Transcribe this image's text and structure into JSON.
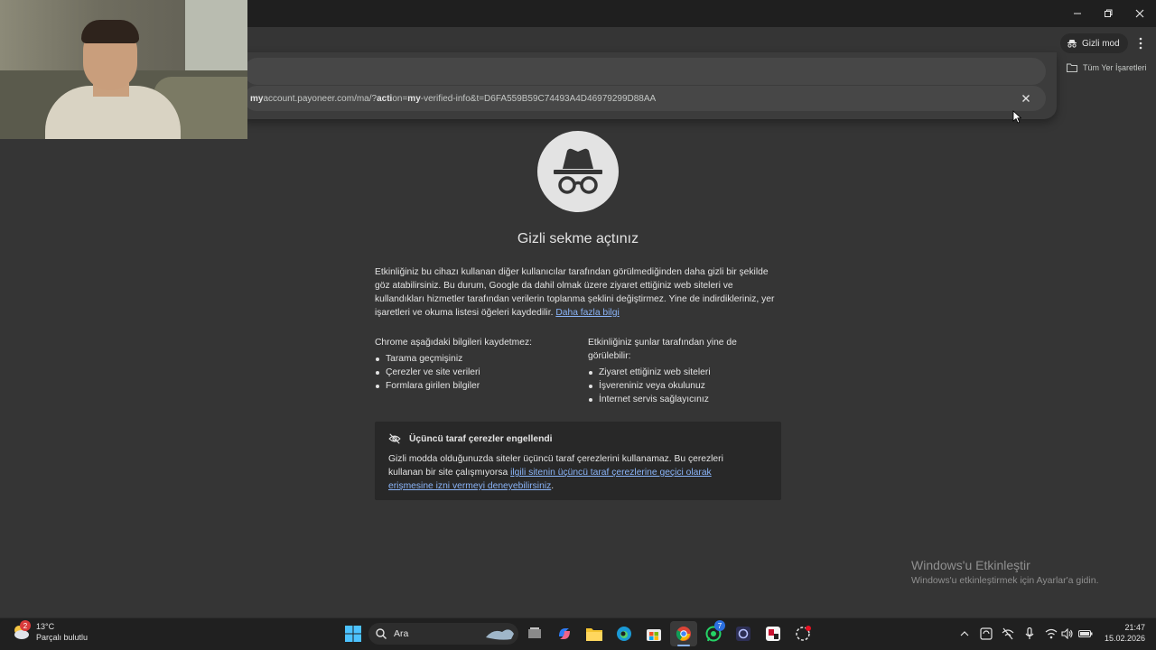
{
  "window": {
    "minimize_icon": "minimize-icon",
    "maximize_icon": "restore-icon",
    "close_icon": "close-icon"
  },
  "toolbar": {
    "incognito_label": "Gizli mod",
    "bookmarks_label": "Tüm Yer İşaretleri"
  },
  "omnibox": {
    "suggestion_bold1": "my",
    "suggestion_text1": "account.payoneer.com/ma/?",
    "suggestion_bold2": "acti",
    "suggestion_text2": "on=",
    "suggestion_bold3": "my",
    "suggestion_text3": "-verified-info&t=D6FA559B59C74493A4D46979299D88AA"
  },
  "page": {
    "title": "Gizli sekme açtınız",
    "intro": "Etkinliğiniz bu cihazı kullanan diğer kullanıcılar tarafından görülmediğinden daha gizli bir şekilde göz atabilirsiniz. Bu durum, Google da dahil olmak üzere ziyaret ettiğiniz web siteleri ve kullandıkları hizmetler tarafından verilerin toplanma şeklini değiştirmez. Yine de indirdikleriniz, yer işaretleri ve okuma listesi öğeleri kaydedilir.",
    "learn_more": "Daha fazla bilgi",
    "left_heading": "Chrome aşağıdaki bilgileri kaydetmez:",
    "left_items": [
      "Tarama geçmişiniz",
      "Çerezler ve site verileri",
      "Formlara girilen bilgiler"
    ],
    "right_heading": "Etkinliğiniz şunlar tarafından yine de görülebilir:",
    "right_items": [
      "Ziyaret ettiğiniz web siteleri",
      "İşvereniniz veya okulunuz",
      "İnternet servis sağlayıcınız"
    ],
    "cookie_title": "Üçüncü taraf çerezler engellendi",
    "cookie_text": "Gizli modda olduğunuzda siteler üçüncü taraf çerezlerini kullanamaz. Bu çerezleri kullanan bir site çalışmıyorsa ",
    "cookie_link": "ilgili sitenin üçüncü taraf çerezlerine geçici olarak erişmesine izni vermeyi deneyebilirsiniz",
    "cookie_end": "."
  },
  "watermark": {
    "title": "Windows'u Etkinleştir",
    "subtitle": "Windows'u etkinleştirmek için Ayarlar'a gidin."
  },
  "taskbar": {
    "weather_temp": "13°C",
    "weather_desc": "Parçalı bulutlu",
    "weather_badge": "2",
    "search_placeholder": "Ara",
    "whatsapp_badge": "7",
    "time": "21:47",
    "date": "15.02.2026"
  },
  "colors": {
    "background": "#353535",
    "link": "#8ab4f8",
    "titlebar": "#1f1f1f",
    "taskbar": "#202020"
  }
}
